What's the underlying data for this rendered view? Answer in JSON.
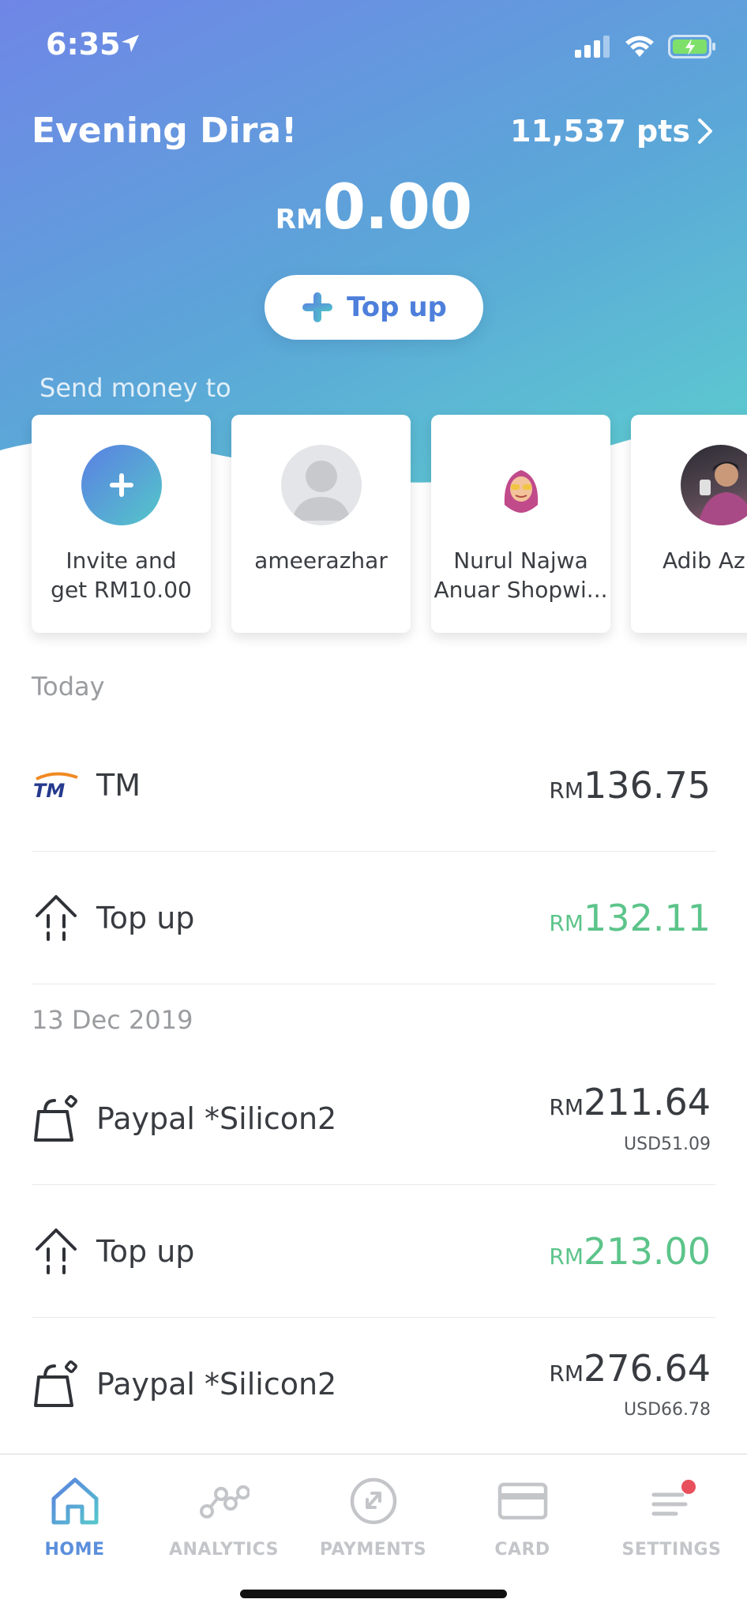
{
  "status_bar": {
    "time": "6:35"
  },
  "header": {
    "greeting": "Evening Dira!",
    "points": "11,537 pts",
    "balance_currency": "RM",
    "balance_amount": "0.00",
    "topup_label": "Top up"
  },
  "send_money": {
    "label": "Send money to",
    "contacts": [
      {
        "name_line1": "Invite and",
        "name_line2": "get RM10.00",
        "avatar": "plus-icon"
      },
      {
        "name_line1": "ameerazhar",
        "name_line2": "",
        "avatar": "default-avatar"
      },
      {
        "name_line1": "Nurul Najwa",
        "name_line2": "Anuar Shopwi...",
        "avatar": "memoji-avatar"
      },
      {
        "name_line1": "Adib Azh",
        "name_line2": "",
        "avatar": "photo-avatar"
      }
    ]
  },
  "transactions": {
    "groups": [
      {
        "label": "Today",
        "items": [
          {
            "name": "TM",
            "currency": "RM",
            "amount": "136.75",
            "icon": "tm-logo",
            "type": "debit"
          },
          {
            "name": "Top up",
            "currency": "RM",
            "amount": "132.11",
            "icon": "topup-arrow-icon",
            "type": "credit"
          }
        ]
      },
      {
        "label": "13 Dec 2019",
        "items": [
          {
            "name": "Paypal *Silicon2",
            "currency": "RM",
            "amount": "211.64",
            "sub": "USD51.09",
            "icon": "shopping-bag-icon",
            "type": "debit"
          },
          {
            "name": "Top up",
            "currency": "RM",
            "amount": "213.00",
            "icon": "topup-arrow-icon",
            "type": "credit"
          },
          {
            "name": "Paypal *Silicon2",
            "currency": "RM",
            "amount": "276.64",
            "sub": "USD66.78",
            "icon": "shopping-bag-icon",
            "type": "debit"
          }
        ]
      }
    ]
  },
  "tabbar": {
    "tabs": [
      {
        "label": "HOME",
        "icon": "home-icon",
        "active": true
      },
      {
        "label": "ANALYTICS",
        "icon": "analytics-icon",
        "active": false
      },
      {
        "label": "PAYMENTS",
        "icon": "payments-icon",
        "active": false
      },
      {
        "label": "CARD",
        "icon": "card-icon",
        "active": false
      },
      {
        "label": "SETTINGS",
        "icon": "settings-icon",
        "active": false
      }
    ]
  },
  "colors": {
    "accent": "#5b8fdc",
    "credit_green": "#5cc48a",
    "gradient_start": "#6f86e6",
    "gradient_end": "#68d8cb",
    "notification_red": "#e8505b"
  }
}
